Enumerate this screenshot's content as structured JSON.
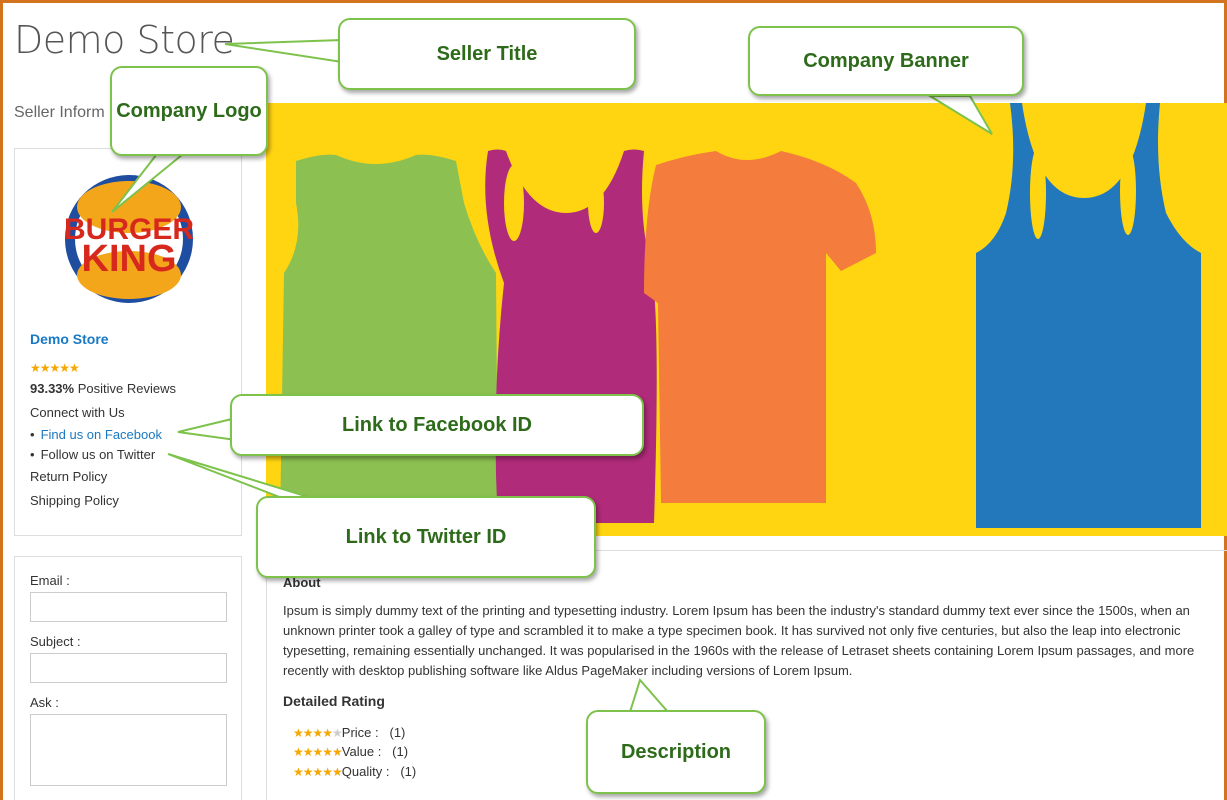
{
  "store": {
    "title": "Demo Store",
    "seller_information": "Seller Inform"
  },
  "seller_card": {
    "logo_text_top": "BURGER",
    "logo_text_bottom": "KING",
    "name": "Demo Store",
    "stars": "★★★★★",
    "positive_pct": "93.33%",
    "positive_label": "Positive Reviews",
    "connect_label": "Connect with Us",
    "facebook_link": "Find us on Facebook",
    "twitter_link": "Follow us on Twitter",
    "return_policy": "Return Policy",
    "shipping_policy": "Shipping Policy"
  },
  "contact_form": {
    "email_label": "Email :",
    "subject_label": "Subject :",
    "ask_label": "Ask :"
  },
  "about": {
    "heading": "About",
    "text": "Ipsum is simply dummy text of the printing and typesetting industry. Lorem Ipsum has been the industry's standard dummy text ever since the 1500s, when an unknown printer took a galley of type and scrambled it to make a type specimen book. It has survived not only five centuries, but also the leap into electronic typesetting, remaining essentially unchanged. It was popularised in the 1960s with the release of Letraset sheets containing Lorem Ipsum passages, and more recently with desktop publishing software like Aldus PageMaker including versions of Lorem Ipsum."
  },
  "detailed_rating": {
    "heading": "Detailed Rating",
    "rows": [
      {
        "label": "Price :",
        "count": "(1)",
        "stars": 4
      },
      {
        "label": "Value :",
        "count": "(1)",
        "stars": 5
      },
      {
        "label": "Quality :",
        "count": "(1)",
        "stars": 5
      }
    ]
  },
  "callouts": {
    "seller_title": "Seller Title",
    "company_logo": "Company Logo",
    "company_banner": "Company Banner",
    "facebook": "Link to Facebook ID",
    "twitter": "Link to Twitter ID",
    "description": "Description"
  },
  "colors": {
    "frame": "#d4731e",
    "banner_bg": "#ffd512",
    "link": "#1979c3",
    "star": "#f6a700",
    "callout_border": "#7dc24b",
    "callout_text": "#2d6b1a"
  }
}
